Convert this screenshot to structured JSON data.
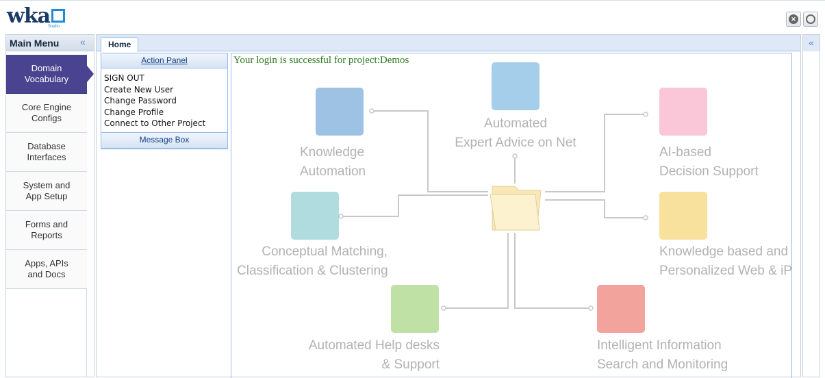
{
  "app": {
    "logo_text": "wka",
    "logo_sub": "Studio"
  },
  "topbar": {
    "close_icon": "close-circle-icon",
    "refresh_icon": "refresh-icon"
  },
  "sidebar": {
    "title": "Main Menu",
    "collapse_glyph": "«",
    "items": [
      {
        "label": "Domain\nVocabulary",
        "active": true
      },
      {
        "label": "Core Engine\nConfigs"
      },
      {
        "label": "Database\nInterfaces"
      },
      {
        "label": "System and\nApp Setup"
      },
      {
        "label": "Forms and\nReports"
      },
      {
        "label": "Apps, APIs\nand Docs"
      }
    ]
  },
  "tabs": [
    {
      "label": "Home"
    }
  ],
  "right_panel": {
    "collapse_glyph": "«"
  },
  "action_panel": {
    "title": "Action Panel",
    "links": [
      "SIGN OUT",
      "Create New User",
      "Change Password",
      "Change Profile",
      "Connect to Other Project"
    ],
    "message_box": "Message Box"
  },
  "content": {
    "login_message": "Your login is successful for project:Demos",
    "diagram": {
      "nodes": [
        {
          "label_1": "Knowledge",
          "label_2": "Automation",
          "color": "#4f8fcc"
        },
        {
          "label_1": "Automated",
          "label_2": "Expert Advice on Net",
          "color": "#5ba6d9"
        },
        {
          "label_1": "AI-based",
          "label_2": "Decision Support",
          "color": "#f48fb1"
        },
        {
          "label_1": "Conceptual Matching,",
          "label_2": "Classification & Clustering",
          "color": "#63b9c0"
        },
        {
          "label_1": "Knowledge based and",
          "label_2": "Personalized Web & iP",
          "color": "#f2c94c"
        },
        {
          "label_1": "Automated Help desks",
          "label_2": "& Support",
          "color": "#8cc95c"
        },
        {
          "label_1": "Intelligent Information",
          "label_2": "Search and Monitoring",
          "color": "#e6584a"
        }
      ],
      "center_icon": "folder-icon"
    }
  }
}
